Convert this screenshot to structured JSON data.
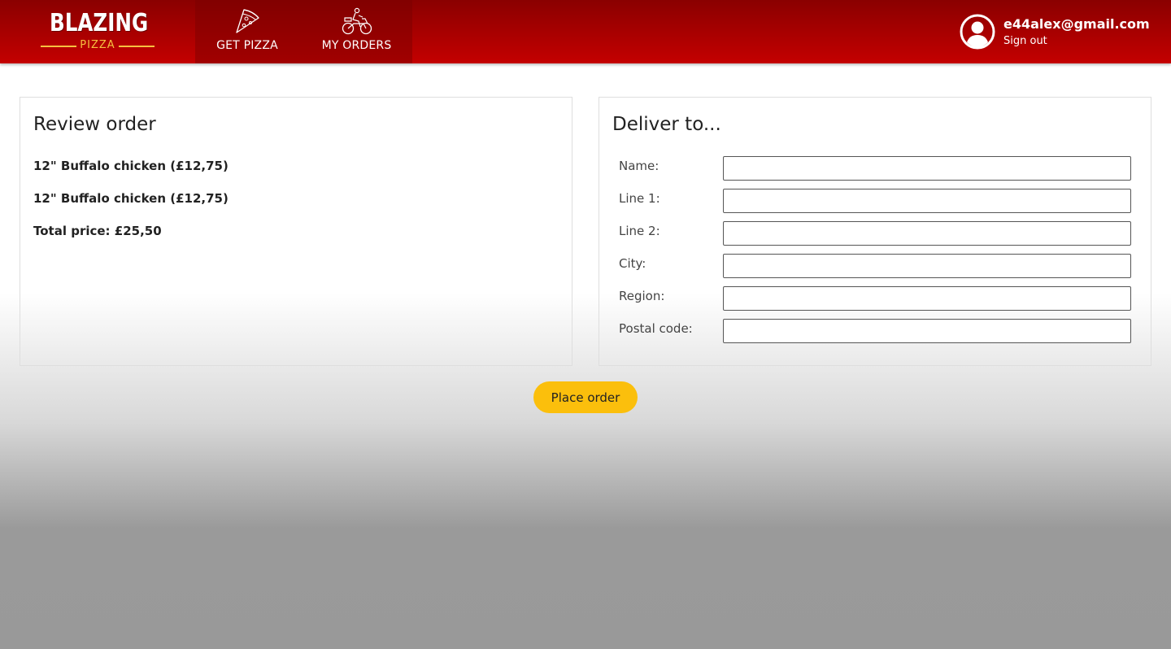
{
  "header": {
    "logo_title": "BLAZING",
    "logo_subtitle": "PIZZA",
    "nav": [
      {
        "label": "GET PIZZA",
        "icon": "pizza-slice-icon"
      },
      {
        "label": "MY ORDERS",
        "icon": "delivery-bike-icon"
      }
    ],
    "user": {
      "email": "e44alex@gmail.com",
      "signout_label": "Sign out",
      "icon": "user-avatar-icon"
    },
    "colors": {
      "bar_top": "#8a0000",
      "bar_bottom": "#c40000",
      "accent": "#f6c040"
    }
  },
  "review": {
    "title": "Review order",
    "items": [
      "12\" Buffalo chicken (£12,75)",
      "12\" Buffalo chicken (£12,75)"
    ],
    "total": "Total price: £25,50"
  },
  "delivery": {
    "title": "Deliver to...",
    "fields": [
      {
        "label": "Name:",
        "value": ""
      },
      {
        "label": "Line 1:",
        "value": ""
      },
      {
        "label": "Line 2:",
        "value": ""
      },
      {
        "label": "City:",
        "value": ""
      },
      {
        "label": "Region:",
        "value": ""
      },
      {
        "label": "Postal code:",
        "value": ""
      }
    ]
  },
  "actions": {
    "place_order_label": "Place order",
    "button_color": "#fbbf0c"
  }
}
